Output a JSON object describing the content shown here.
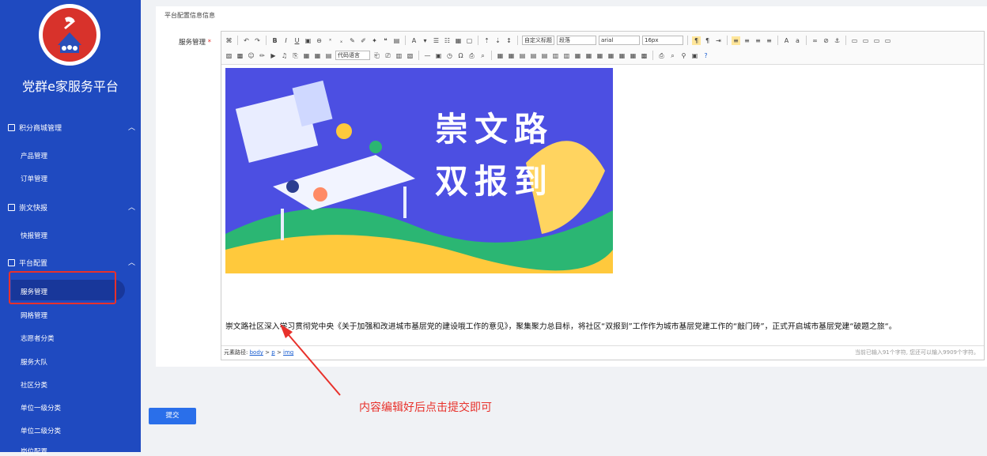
{
  "app": {
    "title": "党群e家服务平台"
  },
  "colors": {
    "sidebar": "#1f4ac0",
    "accent": "#2a6fea",
    "annotation": "#e8312b",
    "banner": "#4c4fe2"
  },
  "sidebar": {
    "groups": [
      {
        "label": "积分商城管理",
        "icon": "gift-icon",
        "items": [
          "产品管理",
          "订单管理"
        ]
      },
      {
        "label": "崇文快报",
        "icon": "news-icon",
        "items": [
          "快报管理"
        ]
      },
      {
        "label": "平台配置",
        "icon": "monitor-icon",
        "items": [
          "服务管理",
          "网格管理",
          "志愿者分类",
          "服务大队",
          "社区分类",
          "单位一级分类",
          "单位二级分类",
          "岗位配置"
        ]
      }
    ],
    "active": "服务管理"
  },
  "content": {
    "section_title": "平台配置信息信息",
    "field_label": "服务管理",
    "required_mark": "*"
  },
  "editor": {
    "toolbar": {
      "custom_title": "自定义标题",
      "paragraph": "段落",
      "font": "arial",
      "size": "16px",
      "code_lang": "代码语言"
    },
    "banner": {
      "line1": "崇文路",
      "line2": "双报到"
    },
    "article": "崇文路社区深入学习贯彻党中央《关于加强和改进城市基层党的建设哦工作的意见》，聚集聚力总目标，将社区“双报到”工作作为城市基层党建工作的“敲门砖”，正式开启城市基层党建“破题之旅“。",
    "path_label": "元素路径:",
    "path_body": "body",
    "path_p": "p",
    "path_img": "img",
    "path_sep": ">",
    "char_count": "当前已输入91个字符, 您还可以输入9909个字符。"
  },
  "submit_label": "提交",
  "annotation": "内容编辑好后点击提交即可"
}
